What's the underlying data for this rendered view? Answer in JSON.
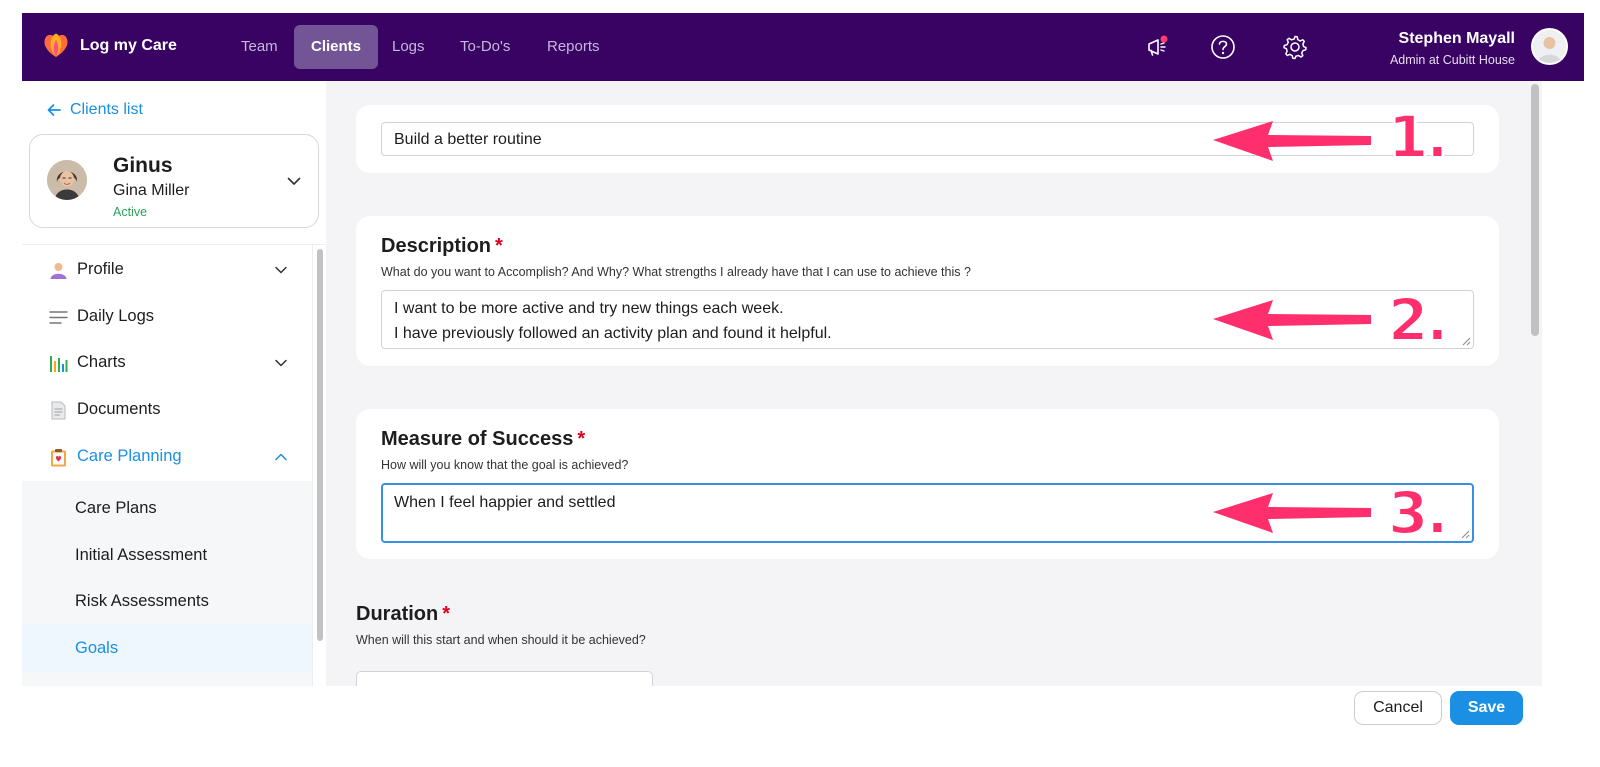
{
  "brand": {
    "name": "Log my Care"
  },
  "nav": {
    "tabs": [
      {
        "label": "Team"
      },
      {
        "label": "Clients"
      },
      {
        "label": "Logs"
      },
      {
        "label": "To-Do's"
      },
      {
        "label": "Reports"
      }
    ],
    "active_tab": "Clients"
  },
  "user": {
    "name": "Stephen Mayall",
    "role": "Admin at Cubitt House"
  },
  "sidebar": {
    "back_label": "Clients list",
    "client": {
      "first_name": "Ginus",
      "full_name": "Gina Miller",
      "status": "Active"
    },
    "menu": [
      {
        "label": "Profile",
        "icon": "profile-icon"
      },
      {
        "label": "Daily Logs",
        "icon": "lines-icon"
      },
      {
        "label": "Charts",
        "icon": "bar-chart-icon"
      },
      {
        "label": "Documents",
        "icon": "document-icon"
      },
      {
        "label": "Care Planning",
        "icon": "clipboard-icon"
      }
    ],
    "submenu": [
      {
        "label": "Care Plans"
      },
      {
        "label": "Initial Assessment"
      },
      {
        "label": "Risk Assessments"
      },
      {
        "label": "Goals"
      }
    ]
  },
  "form": {
    "goal_title": {
      "value": "Build a better routine"
    },
    "description": {
      "title": "Description",
      "required_mark": "*",
      "hint": "What do you want to Accomplish? And Why? What strengths I already have that I can use to achieve this ?",
      "line1": "I want to be more active and try new things each week.",
      "line2": "I have previously followed an activity plan and found it helpful."
    },
    "measure": {
      "title": "Measure of Success",
      "required_mark": "*",
      "hint": "How will you know that the goal is achieved?",
      "value": "When I feel happier and settled"
    },
    "duration": {
      "title": "Duration",
      "required_mark": "*",
      "hint": "When will this start and when should it be achieved?"
    }
  },
  "annotations": {
    "n1": "1.",
    "n2": "2.",
    "n3": "3.",
    "color": "#ff2f6d"
  },
  "footer": {
    "cancel_label": "Cancel",
    "save_label": "Save"
  },
  "colors": {
    "nav_bg": "#380362",
    "accent": "#1a8fe3",
    "active_status": "#29a35a",
    "required": "#e0001b"
  }
}
